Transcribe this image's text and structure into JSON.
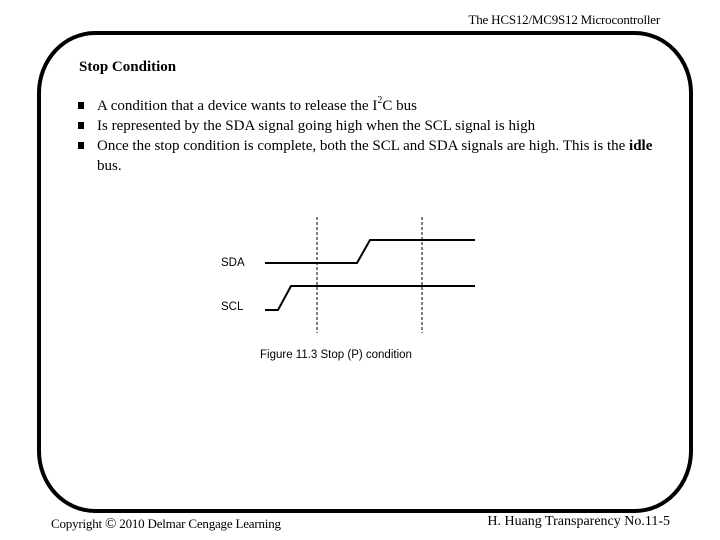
{
  "header": {
    "title": "The HCS12/MC9S12 Microcontroller"
  },
  "slide": {
    "title": "Stop Condition",
    "bullets": [
      {
        "pre": "A condition that a device wants to release the I",
        "sup": "2",
        "post": "C bus"
      },
      {
        "text": "Is represented by the SDA signal going high when the SCL signal is high"
      },
      {
        "pre": "Once the stop condition is complete, both the SCL and SDA signals are high. This is the ",
        "bold": "idle",
        "post": " bus."
      }
    ],
    "bullet_icon": "square-bullet-icon"
  },
  "figure": {
    "signals": [
      {
        "name": "SDA",
        "sequence": [
          "low",
          "high"
        ],
        "transition": "rising after first marker"
      },
      {
        "name": "SCL",
        "sequence": [
          "low",
          "high"
        ],
        "transition": "rising before first marker"
      }
    ],
    "markers": 2,
    "caption": "Figure 11.3 Stop (P) condition"
  },
  "footer": {
    "copyright_prefix": "Copyright",
    "copyright_symbol": "©",
    "copyright_text": "2010 Delmar Cengage Learning",
    "right": "H. Huang Transparency No.11-5"
  }
}
